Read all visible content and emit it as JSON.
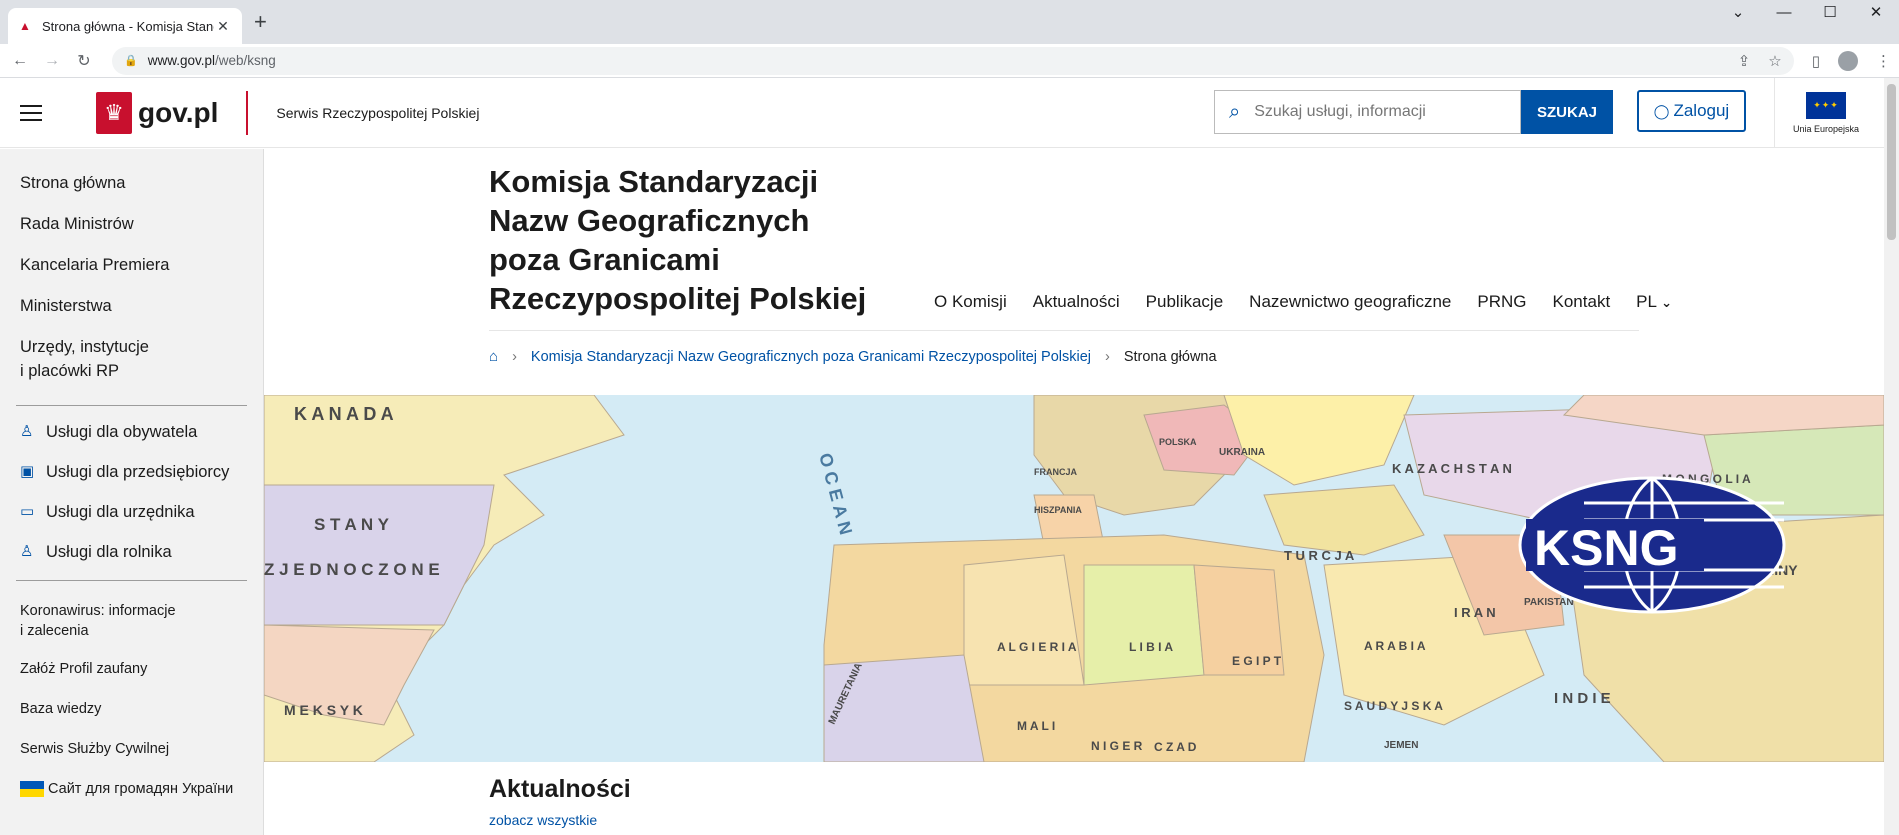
{
  "browser": {
    "tab_title": "Strona główna - Komisja Standar",
    "url_domain": "www.gov.pl",
    "url_path": "/web/ksng"
  },
  "header": {
    "logo_text": "gov.pl",
    "service_name": "Serwis Rzeczypospolitej Polskiej",
    "search_placeholder": "Szukaj usługi, informacji",
    "search_button": "SZUKAJ",
    "login_label": "Zaloguj",
    "eu_label": "Unia Europejska"
  },
  "sidebar": {
    "main_items": [
      "Strona główna",
      "Rada Ministrów",
      "Kancelaria Premiera",
      "Ministerstwa",
      "Urzędy, instytucje",
      "i placówki RP"
    ],
    "services": [
      "Usługi dla obywatela",
      "Usługi dla przedsiębiorcy",
      "Usługi dla urzędnika",
      "Usługi dla rolnika"
    ],
    "extra": [
      "Koronawirus: informacje",
      "i zalecenia",
      "Załóż Profil zaufany",
      "Baza wiedzy",
      "Serwis Służby Cywilnej",
      "Сайт для громадян України"
    ]
  },
  "main": {
    "title_lines": [
      "Komisja Standaryzacji",
      "Nazw Geograficznych",
      "poza Granicami",
      "Rzeczypospolitej Polskiej"
    ],
    "nav": [
      "O Komisji",
      "Aktualności",
      "Publikacje",
      "Nazewnictwo geograficzne",
      "PRNG",
      "Kontakt",
      "PL"
    ],
    "breadcrumb_link": "Komisja Standaryzacji Nazw Geograficznych poza Granicami Rzeczypospolitej Polskiej",
    "breadcrumb_current": "Strona główna",
    "news_title": "Aktualności",
    "news_link": "zobacz wszystkie"
  },
  "banner": {
    "logo_text": "KSNG",
    "map_labels": [
      "K A N A D A",
      "S T A N Y",
      "Z J E D N O C Z O N E",
      "M E K S Y K",
      "O C E A N",
      "A L G I E R I A",
      "L I B I A",
      "E G I P T",
      "M A L I",
      "N I G E R",
      "C Z A D",
      "T U R C J A",
      "I R A N",
      "A R A B I A",
      "S A U D Y J S K A",
      "K A Z A C H S T A N",
      "M O N G O L I A",
      "I N D I E",
      "UKRAINA",
      "POLSKA",
      "FRANCJA",
      "HISZPANIA",
      "MAURETANIA",
      "JEMEN",
      "PAKISTAN",
      "CHINY"
    ]
  },
  "colors": {
    "accent": "#0052a5",
    "brand_red": "#c8102e",
    "ocean": "#d4ebf5",
    "ksng_blue": "#1a2a8c"
  }
}
